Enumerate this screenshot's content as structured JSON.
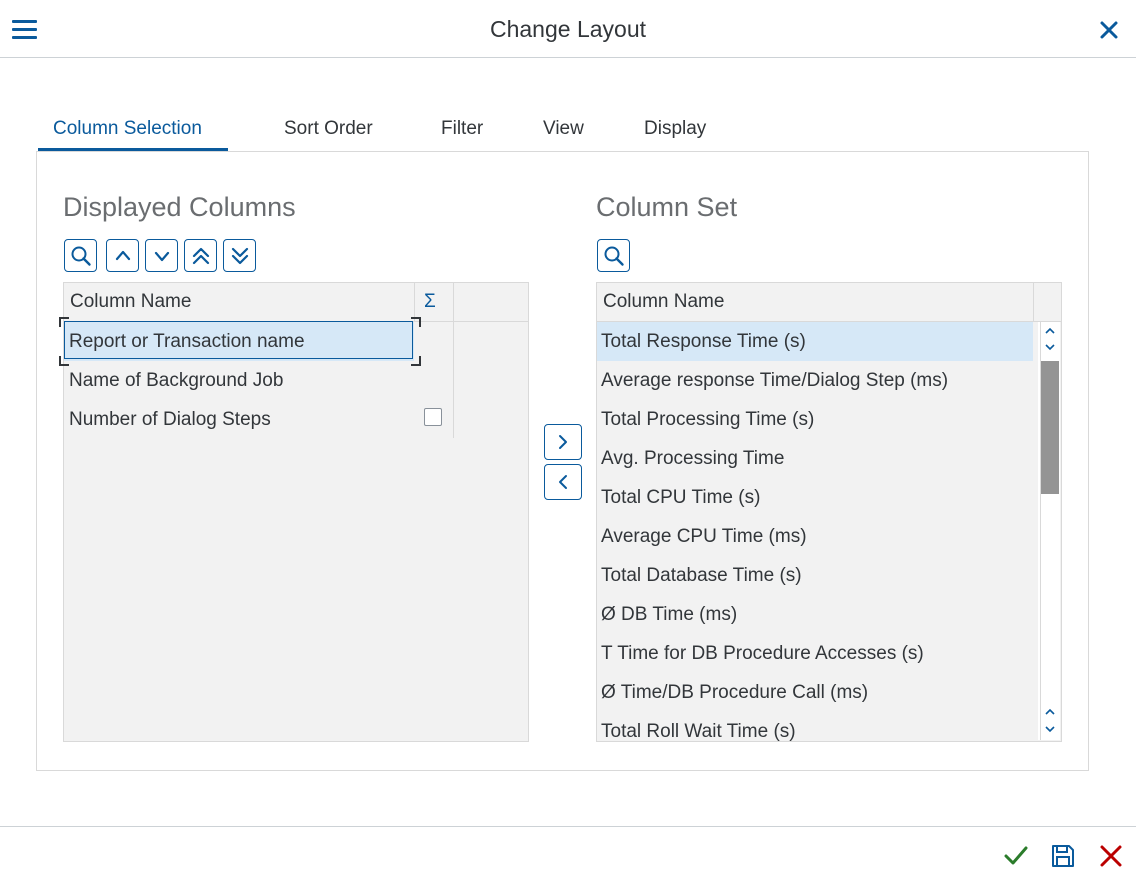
{
  "header": {
    "title": "Change Layout",
    "menu_icon": "hamburger-menu-icon",
    "close_icon": "close-icon"
  },
  "tabs": [
    {
      "label": "Column Selection",
      "active": true
    },
    {
      "label": "Sort Order"
    },
    {
      "label": "Filter"
    },
    {
      "label": "View"
    },
    {
      "label": "Display"
    }
  ],
  "displayed": {
    "title": "Displayed Columns",
    "header_label": "Column Name",
    "sum_symbol": "Σ",
    "rows": [
      {
        "label": "Report or Transaction name",
        "selected": true
      },
      {
        "label": "Name of Background Job"
      },
      {
        "label": "Number of Dialog Steps",
        "has_checkbox": true,
        "checked": false
      }
    ]
  },
  "column_set": {
    "title": "Column Set",
    "header_label": "Column Name",
    "rows": [
      {
        "label": "Total Response Time (s)",
        "selected": true
      },
      {
        "label": "Average response Time/Dialog Step (ms)"
      },
      {
        "label": "Total Processing Time (s)"
      },
      {
        "label": "Avg. Processing Time"
      },
      {
        "label": "Total CPU Time (s)"
      },
      {
        "label": "Average CPU Time (ms)"
      },
      {
        "label": "Total Database Time (s)"
      },
      {
        "label": "Ø DB Time (ms)"
      },
      {
        "label": "T Time for DB Procedure Accesses (s)"
      },
      {
        "label": "Ø Time/DB Procedure Call (ms)"
      },
      {
        "label": "Total Roll Wait Time (s)"
      }
    ]
  },
  "colors": {
    "accent": "#0a5a9c",
    "confirm": "#2b7c2b",
    "cancel": "#bb0000",
    "selection": "#d6e8f7"
  },
  "icons": {
    "search": "search-icon",
    "up": "move-up-icon",
    "down": "move-down-icon",
    "top": "move-to-top-icon",
    "bottom": "move-to-bottom-icon",
    "add": "add-column-icon",
    "remove": "remove-column-icon",
    "ok": "checkmark-icon",
    "save": "save-icon",
    "cancel": "cancel-icon"
  }
}
